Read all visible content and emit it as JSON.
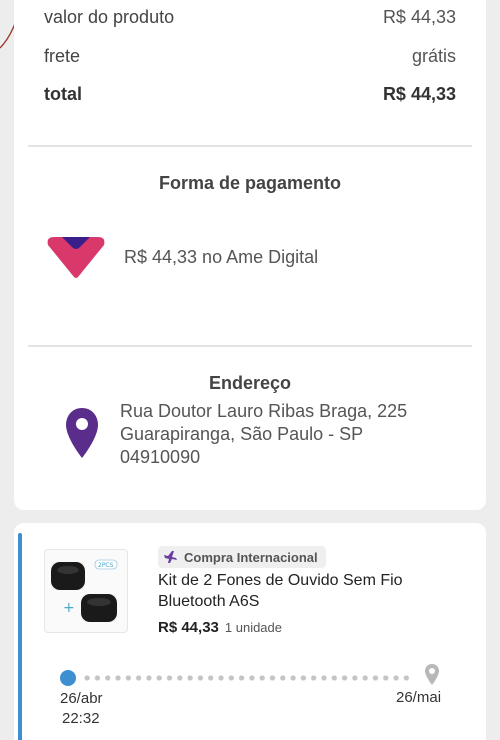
{
  "summary": {
    "product_value_label": "valor do produto",
    "product_value": "R$ 44,33",
    "shipping_label": "frete",
    "shipping_value": "grátis",
    "total_label": "total",
    "total_value": "R$ 44,33"
  },
  "payment": {
    "title": "Forma de pagamento",
    "text": "R$ 44,33 no Ame Digital",
    "icon": "ame-digital-logo-icon",
    "colors": {
      "heart": "#d8386a",
      "heart_top": "#3a1f8a"
    }
  },
  "address": {
    "title": "Endereço",
    "line1": "Rua Doutor Lauro Ribas Braga, 225",
    "line2": "Guarapiranga, São Paulo - SP",
    "line3": "04910090",
    "icon": "map-pin-icon",
    "color": "#5a2d8c"
  },
  "order": {
    "badge": "Compra Internacional",
    "badge_icon": "airplane-icon",
    "product_name": "Kit de 2 Fones de Ouvido Sem Fio Bluetooth A6S",
    "thumb_tag": "2PCS",
    "price": "R$ 44,33",
    "quantity": "1 unidade",
    "timeline": {
      "start_date": "26/abr",
      "start_time": "22:32",
      "end_date": "26/mai",
      "color": "#3d8fd1"
    }
  }
}
